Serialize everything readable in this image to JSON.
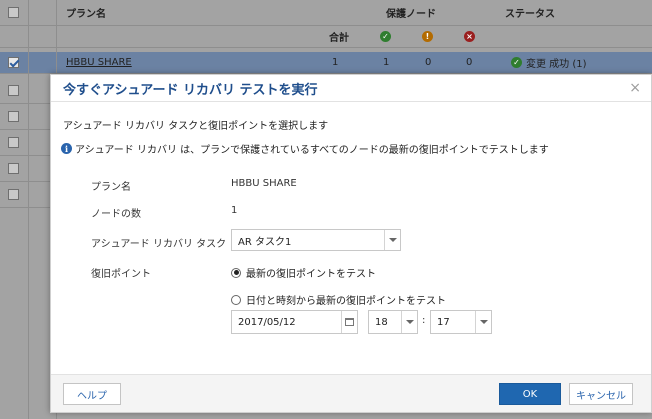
{
  "background": {
    "header": {
      "plan_name": "プラン名",
      "protected_nodes": "保護ノード",
      "status": "ステータス",
      "total": "合計"
    },
    "row": {
      "plan": "HBBU SHARE",
      "total": "1",
      "ok": "1",
      "warn": "0",
      "error": "0",
      "status": "変更 成功 (1)"
    }
  },
  "dialog": {
    "title": "今すぐアシュアード リカバリ テストを実行",
    "close_glyph": "×",
    "instruction": "アシュアード リカバリ タスクと復旧ポイントを選択します",
    "info": "アシュアード リカバリ は、プランで保護されているすべてのノードの最新の復旧ポイントでテストします",
    "fields": {
      "plan_label": "プラン名",
      "plan_value": "HBBU SHARE",
      "node_count_label": "ノードの数",
      "node_count_value": "1",
      "task_label": "アシュアード リカバリ タスク",
      "task_value": "AR タスク1",
      "recovery_point_label": "復旧ポイント",
      "option_latest": "最新の復旧ポイントをテスト",
      "option_from_date": "日付と時刻から最新の復旧ポイントをテスト",
      "date_value": "2017/05/12",
      "hour_value": "18",
      "minute_value": "17",
      "time_separator": ":"
    },
    "buttons": {
      "help": "ヘルプ",
      "ok": "OK",
      "cancel": "キャンセル"
    }
  },
  "colors": {
    "title": "#1f4e8c",
    "primary_button": "#1f67b0",
    "info_icon": "#2a64ad"
  }
}
